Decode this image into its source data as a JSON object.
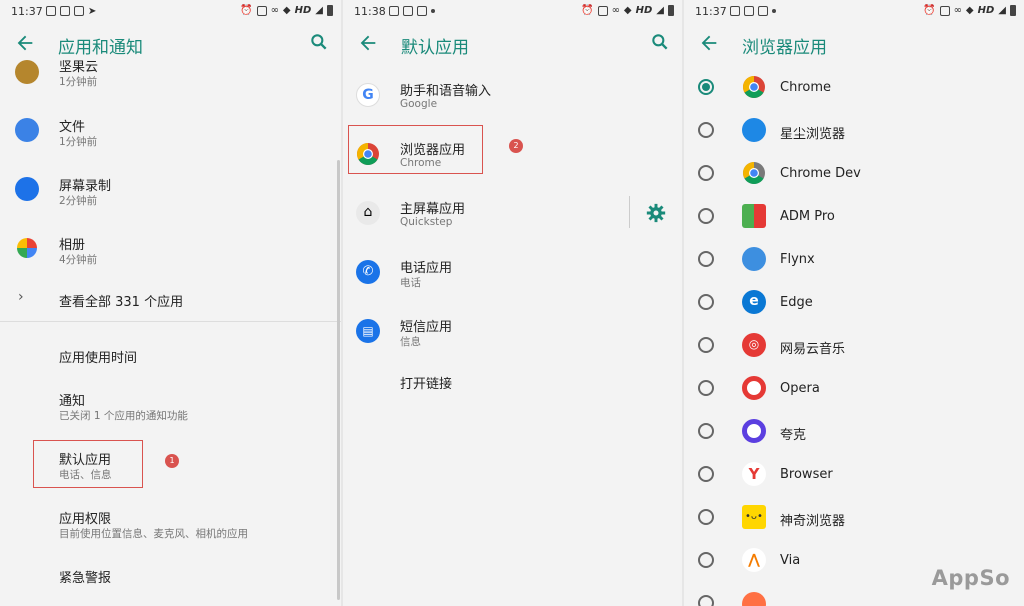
{
  "panel1": {
    "status": {
      "time": "11:37",
      "hd": "HD"
    },
    "title": "应用和通知",
    "apps": [
      {
        "name": "坚果云",
        "sub": "1分钟前"
      },
      {
        "name": "文件",
        "sub": "1分钟前"
      },
      {
        "name": "屏幕录制",
        "sub": "2分钟前"
      },
      {
        "name": "相册",
        "sub": "4分钟前"
      }
    ],
    "see_all": "查看全部 331 个应用",
    "items": [
      {
        "name": "应用使用时间"
      },
      {
        "name": "通知",
        "sub": "已关闭 1 个应用的通知功能"
      },
      {
        "name": "默认应用",
        "sub": "电话、信息"
      },
      {
        "name": "应用权限",
        "sub": "目前使用位置信息、麦克风、相机的应用"
      },
      {
        "name": "紧急警报"
      }
    ],
    "badge": "1"
  },
  "panel2": {
    "status": {
      "time": "11:38",
      "hd": "HD"
    },
    "title": "默认应用",
    "items": [
      {
        "name": "助手和语音输入",
        "sub": "Google"
      },
      {
        "name": "浏览器应用",
        "sub": "Chrome"
      },
      {
        "name": "主屏幕应用",
        "sub": "Quickstep"
      },
      {
        "name": "电话应用",
        "sub": "电话"
      },
      {
        "name": "短信应用",
        "sub": "信息"
      },
      {
        "name": "打开链接"
      }
    ],
    "badge": "2"
  },
  "panel3": {
    "status": {
      "time": "11:37",
      "hd": "HD"
    },
    "title": "浏览器应用",
    "browsers": [
      {
        "name": "Chrome",
        "selected": true
      },
      {
        "name": "星尘浏览器"
      },
      {
        "name": "Chrome Dev"
      },
      {
        "name": "ADM Pro"
      },
      {
        "name": "Flynx"
      },
      {
        "name": "Edge"
      },
      {
        "name": "网易云音乐"
      },
      {
        "name": "Opera"
      },
      {
        "name": "夸克"
      },
      {
        "name": "Browser"
      },
      {
        "name": "神奇浏览器"
      },
      {
        "name": "Via"
      }
    ]
  },
  "watermark": "AppSo",
  "colors": {
    "accent": "#1a8a7a",
    "highlight": "#d9534f"
  }
}
